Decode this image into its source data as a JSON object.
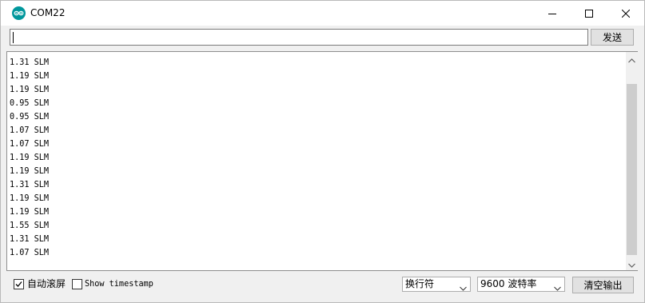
{
  "window": {
    "title": "COM22",
    "icon": "arduino-icon",
    "controls": [
      "minimize-icon",
      "maximize-icon",
      "close-icon"
    ]
  },
  "send": {
    "input_value": "",
    "button_label": "发送"
  },
  "output": {
    "lines": [
      "1.31 SLM",
      "1.19 SLM",
      "1.19 SLM",
      "0.95 SLM",
      "0.95 SLM",
      "1.07 SLM",
      "1.07 SLM",
      "1.19 SLM",
      "1.19 SLM",
      "1.31 SLM",
      "1.19 SLM",
      "1.19 SLM",
      "1.55 SLM",
      "1.31 SLM",
      "1.07 SLM"
    ]
  },
  "bottom": {
    "autoscroll": {
      "label": "自动滚屏",
      "checked": true
    },
    "timestamp": {
      "label": "Show timestamp",
      "checked": false
    },
    "line_ending": "换行符",
    "baud_rate": "9600 波特率",
    "clear_label": "清空输出"
  },
  "colors": {
    "arduino_teal": "#00979C",
    "window_bg": "#f0f0f0",
    "scroll_thumb": "#cdcdcd"
  }
}
